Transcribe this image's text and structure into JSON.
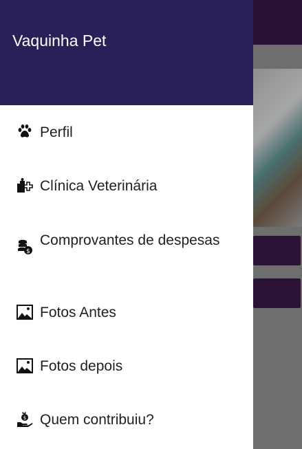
{
  "app": {
    "title": "Vaquinha Pet"
  },
  "menu": {
    "items": [
      {
        "label": "Perfil",
        "icon": "paw-icon"
      },
      {
        "label": "Clínica Veterinária",
        "icon": "vet-clinic-icon"
      },
      {
        "label": "Comprovantes de despesas",
        "icon": "coins-icon"
      },
      {
        "label": "Fotos Antes",
        "icon": "image-icon"
      },
      {
        "label": "Fotos depois",
        "icon": "image-icon"
      },
      {
        "label": "Quem contribuiu?",
        "icon": "donation-hand-icon"
      }
    ]
  },
  "colors": {
    "header": "#2a2057",
    "scrim_background": "#6e6e6e",
    "background_accent": "#2b1337"
  }
}
